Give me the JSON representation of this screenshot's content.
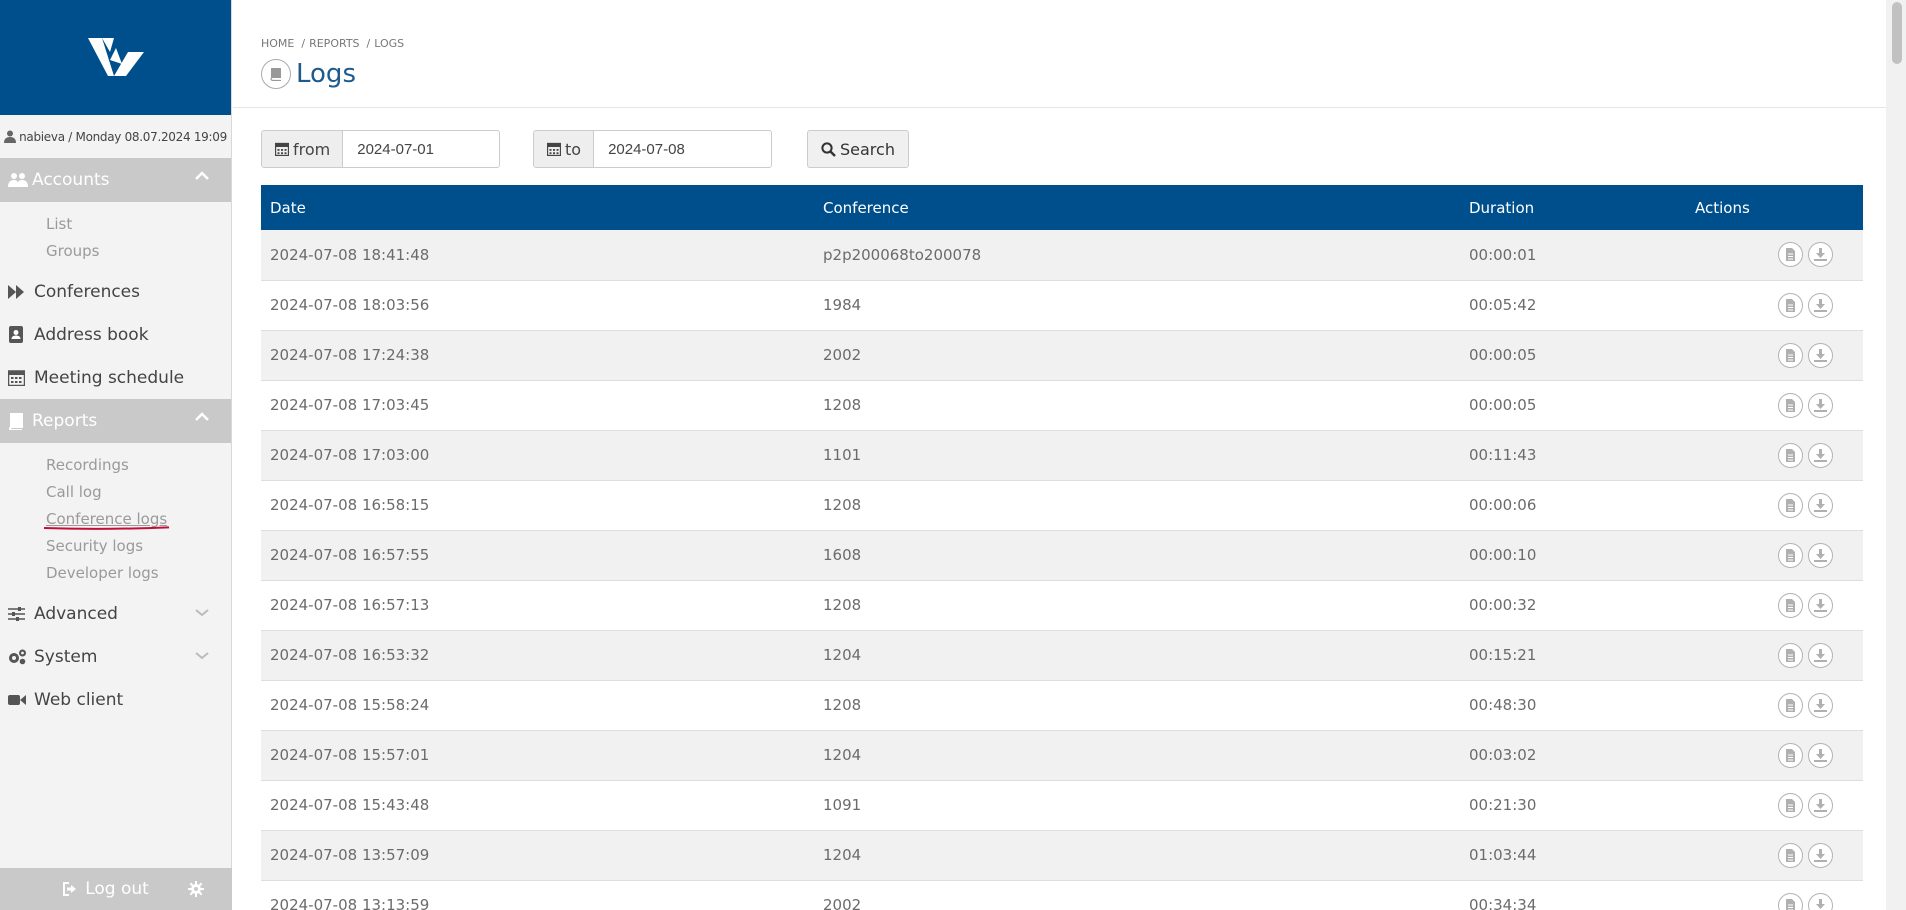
{
  "sidebar": {
    "user_line": "nabieva / Monday 08.07.2024 19:09",
    "accounts": {
      "label": "Accounts",
      "items": [
        "List",
        "Groups"
      ]
    },
    "conferences": "Conferences",
    "address_book": "Address book",
    "meeting_schedule": "Meeting schedule",
    "reports": {
      "label": "Reports",
      "items": [
        "Recordings",
        "Call log",
        "Conference logs",
        "Security logs",
        "Developer logs"
      ]
    },
    "advanced": "Advanced",
    "system": "System",
    "web_client": "Web client",
    "logout": "Log out",
    "accent_color": "#004f8d"
  },
  "breadcrumb": [
    "HOME",
    "REPORTS",
    "LOGS"
  ],
  "page_title": "Logs",
  "filters": {
    "from_label": "from",
    "from_value": "2024-07-01",
    "to_label": "to",
    "to_value": "2024-07-08",
    "search_label": "Search"
  },
  "table": {
    "headers": [
      "Date",
      "Conference",
      "Duration",
      "Actions"
    ],
    "rows": [
      [
        "2024-07-08 18:41:48",
        "p2p200068to200078",
        "00:00:01"
      ],
      [
        "2024-07-08 18:03:56",
        "1984",
        "00:05:42"
      ],
      [
        "2024-07-08 17:24:38",
        "2002",
        "00:00:05"
      ],
      [
        "2024-07-08 17:03:45",
        "1208",
        "00:00:05"
      ],
      [
        "2024-07-08 17:03:00",
        "1101",
        "00:11:43"
      ],
      [
        "2024-07-08 16:58:15",
        "1208",
        "00:00:06"
      ],
      [
        "2024-07-08 16:57:55",
        "1608",
        "00:00:10"
      ],
      [
        "2024-07-08 16:57:13",
        "1208",
        "00:00:32"
      ],
      [
        "2024-07-08 16:53:32",
        "1204",
        "00:15:21"
      ],
      [
        "2024-07-08 15:58:24",
        "1208",
        "00:48:30"
      ],
      [
        "2024-07-08 15:57:01",
        "1204",
        "00:03:02"
      ],
      [
        "2024-07-08 15:43:48",
        "1091",
        "00:21:30"
      ],
      [
        "2024-07-08 13:57:09",
        "1204",
        "01:03:44"
      ],
      [
        "2024-07-08 13:13:59",
        "2002",
        "00:34:34"
      ]
    ],
    "row_actions": [
      "document-icon",
      "download-icon"
    ]
  }
}
